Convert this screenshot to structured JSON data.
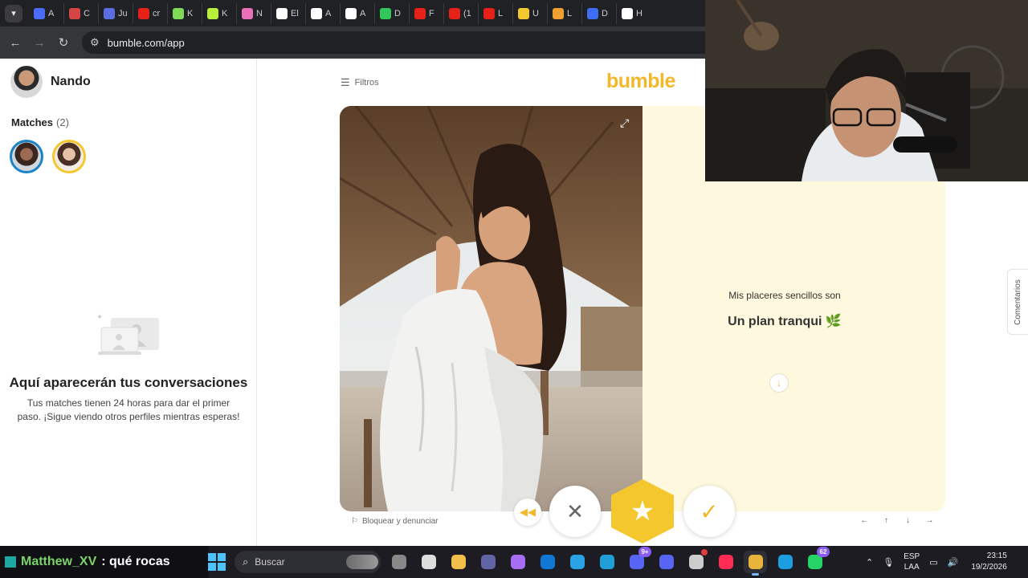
{
  "browser": {
    "tabs": [
      {
        "icon": "globe-tab-icon",
        "label": "A",
        "color": "#4a6cf7"
      },
      {
        "icon": "circle-tab-icon",
        "label": "C",
        "color": "#d64545"
      },
      {
        "icon": "logo-tab-icon",
        "label": "Ju",
        "color": "#5b6ee1"
      },
      {
        "icon": "youtube-tab-icon",
        "label": "cr",
        "color": "#e62117"
      },
      {
        "icon": "clover-tab-icon",
        "label": "K",
        "color": "#7ed957"
      },
      {
        "icon": "d-tab-icon",
        "label": "K",
        "color": "#b7f03b"
      },
      {
        "icon": "image-tab-icon",
        "label": "N",
        "color": "#e96fb8"
      },
      {
        "icon": "diamond-tab-icon",
        "label": "El",
        "color": "#ffffff"
      },
      {
        "icon": "amazon-tab-icon",
        "label": "A",
        "color": "#ffffff"
      },
      {
        "icon": "amazon-tab-icon",
        "label": "A",
        "color": "#ffffff"
      },
      {
        "icon": "download-tab-icon",
        "label": "D",
        "color": "#34c759"
      },
      {
        "icon": "youtube-tab-icon",
        "label": "F",
        "color": "#e62117"
      },
      {
        "icon": "youtube-tab-icon",
        "label": "(1",
        "color": "#e62117"
      },
      {
        "icon": "youtube-tab-icon",
        "label": "L",
        "color": "#e62117"
      },
      {
        "icon": "star-tab-icon",
        "label": "U",
        "color": "#f5c72e"
      },
      {
        "icon": "in-tab-icon",
        "label": "L",
        "color": "#f0a030"
      },
      {
        "icon": "arrow-tab-icon",
        "label": "D",
        "color": "#3d6ef5"
      },
      {
        "icon": "circle-tab-icon",
        "label": "H",
        "color": "#ffffff"
      }
    ],
    "url": "bumble.com/app"
  },
  "sidebar": {
    "user_name": "Nando",
    "matches_label": "Matches",
    "matches_count": "(2)",
    "empty_title": "Aquí aparecerán tus conversaciones",
    "empty_subtitle": "Tus matches tienen 24 horas para dar el primer paso. ¡Sigue viendo otros perfiles mientras esperas!"
  },
  "main": {
    "filters_label": "Filtros",
    "logo": "bumble",
    "prompt_question": "Mis placeres sencillos son",
    "prompt_answer": "Un plan tranqui",
    "prompt_emoji": "🌿",
    "report_label": "Bloquear y denunciar",
    "keyboard_hints": [
      "←",
      "↑",
      "↓",
      "→"
    ],
    "comments_tab": "Comentarios"
  },
  "colors": {
    "accent": "#f5c72e",
    "card_bg": "#fef8de",
    "match_ring_1": "#1c83c6",
    "match_ring_2": "#f5c72e"
  },
  "taskbar": {
    "chat_user": "Matthew_XV",
    "chat_message": ": qué rocas",
    "search_placeholder": "Buscar",
    "apps": [
      {
        "icon": "task-view-icon",
        "label": "",
        "color": "#888888"
      },
      {
        "icon": "media-icon",
        "label": "",
        "color": "#dddddd"
      },
      {
        "icon": "file-explorer-icon",
        "label": "",
        "color": "#f2c04a"
      },
      {
        "icon": "teams-icon",
        "label": "",
        "color": "#6264a7"
      },
      {
        "icon": "copilot-icon",
        "label": "",
        "color": "#a86cf5"
      },
      {
        "icon": "outlook-icon",
        "label": "",
        "color": "#0f78d4"
      },
      {
        "icon": "store-icon",
        "label": "",
        "color": "#2aa3e6"
      },
      {
        "icon": "edge-icon",
        "label": "",
        "color": "#1fa1d8"
      },
      {
        "icon": "discord-icon",
        "label": "",
        "color": "#5865f2",
        "badge": "9+"
      },
      {
        "icon": "app-icon",
        "label": "",
        "color": "#5865f2"
      },
      {
        "icon": "obs-icon",
        "label": "",
        "color": "#cccccc",
        "badge_red": true
      },
      {
        "icon": "tiktok-icon",
        "label": "",
        "color": "#ff2d55"
      },
      {
        "icon": "chrome-icon",
        "label": "",
        "color": "#e9b43b",
        "active": true
      },
      {
        "icon": "steam-icon",
        "label": "",
        "color": "#1b9fe0"
      },
      {
        "icon": "whatsapp-icon",
        "label": "",
        "color": "#25d366",
        "badge": "62"
      }
    ],
    "lang_top": "ESP",
    "lang_bottom": "LAA",
    "time": "23:15",
    "date": "19/2/2026"
  }
}
